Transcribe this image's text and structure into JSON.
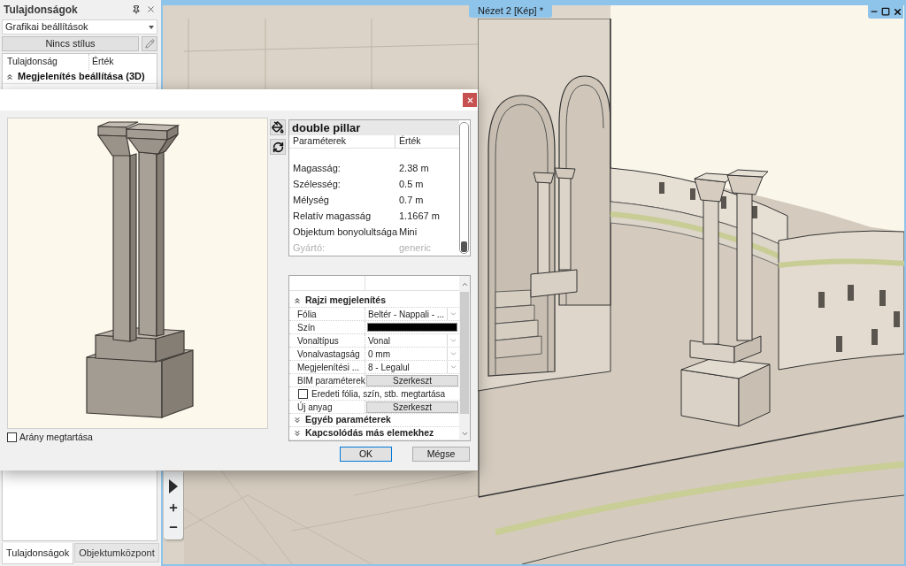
{
  "properties_panel": {
    "title": "Tulajdonságok",
    "category_dropdown": {
      "value": "Grafikai beállítások"
    },
    "style_button": {
      "label": "Nincs stílus"
    },
    "columns": [
      "Tulajdonság",
      "Érték"
    ],
    "group": {
      "label": "Megjelenítés beállítása (3D)",
      "expanded": true
    },
    "tabs": [
      {
        "label": "Tulajdonságok",
        "selected": true
      },
      {
        "label": "Objektumközpont",
        "selected": false
      }
    ]
  },
  "viewport": {
    "tab": {
      "title": "Nézet 2 [Kép] *"
    }
  },
  "dialog": {
    "preview": {
      "checkbox": {
        "label": "Arány megtartása",
        "checked": false
      }
    },
    "info": {
      "title": "double pillar",
      "columns": [
        "Paraméterek",
        "Érték"
      ],
      "rows": [
        {
          "name": "Magasság:",
          "value": "2.38 m",
          "disabled": false
        },
        {
          "name": "Szélesség:",
          "value": "0.5 m",
          "disabled": false
        },
        {
          "name": "Mélység",
          "value": "0.7 m",
          "disabled": false
        },
        {
          "name": "Relatív magasság",
          "value": "1.1667 m",
          "disabled": false
        },
        {
          "name": "Objektum bonyolultsága",
          "value": "Mini",
          "disabled": false
        },
        {
          "name": "Gyártó:",
          "value": "generic",
          "disabled": true
        }
      ]
    },
    "grid": {
      "sections": [
        {
          "label": "Rajzi megjelenítés",
          "expanded": true,
          "rows": [
            {
              "kind": "dropdown",
              "label": "Fólia",
              "value": "Beltér - Nappali - ..."
            },
            {
              "kind": "color",
              "label": "Szín",
              "color": "#000000"
            },
            {
              "kind": "dropdown",
              "label": "Vonaltípus",
              "value": "Vonal"
            },
            {
              "kind": "dropdown",
              "label": "Vonalvastagság",
              "value": "0 mm"
            },
            {
              "kind": "dropdown",
              "label": "Megjelenítési ...",
              "value": "8 - Legalul"
            },
            {
              "kind": "button",
              "label": "BIM paraméterek",
              "value": "Szerkeszt"
            },
            {
              "kind": "checkbox",
              "label": "Eredeti fólia, szín, stb. megtartása",
              "checked": false
            },
            {
              "kind": "button",
              "label": "Új anyag",
              "value": "Szerkeszt"
            }
          ]
        },
        {
          "label": "Egyéb paraméterek",
          "expanded": false
        },
        {
          "label": "Kapcsolódás más elemekhez",
          "expanded": false
        }
      ]
    },
    "buttons": [
      {
        "label": "OK",
        "default": true
      },
      {
        "label": "Mégse",
        "default": false
      }
    ]
  }
}
